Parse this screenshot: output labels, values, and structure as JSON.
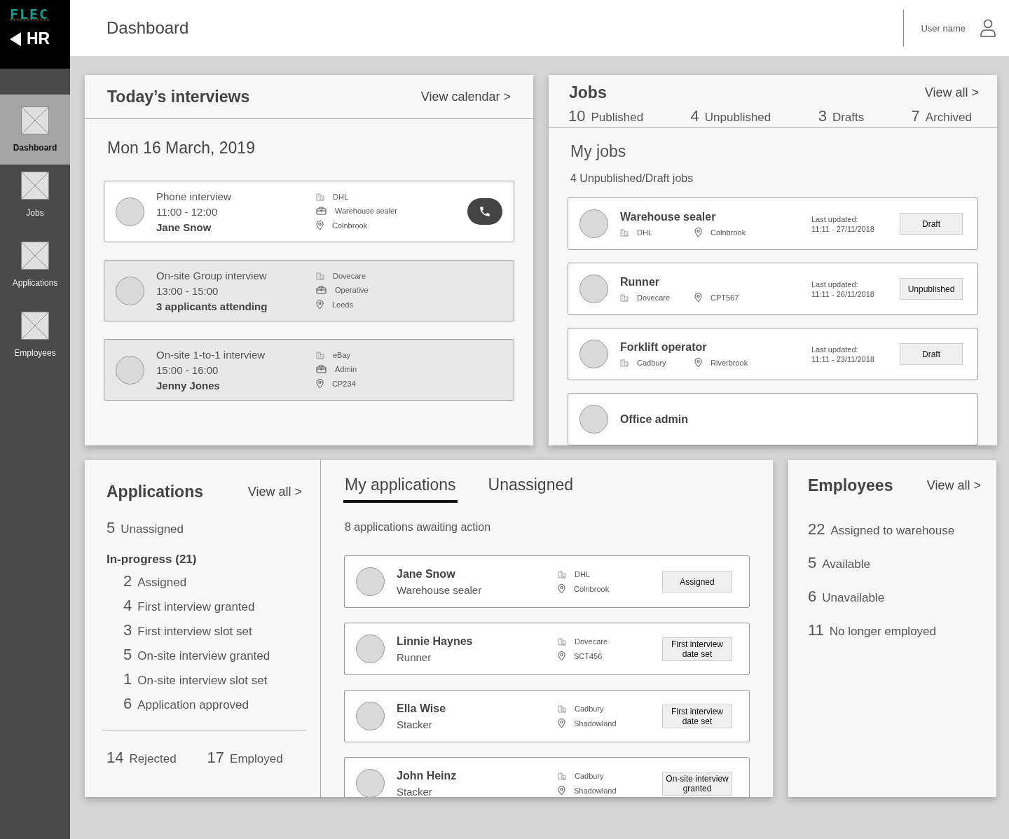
{
  "logo": {
    "brand": "FLEC",
    "section": "HR"
  },
  "sidebar": {
    "items": [
      {
        "label": "Dashboard",
        "selected": true
      },
      {
        "label": "Jobs",
        "selected": false
      },
      {
        "label": "Applications",
        "selected": false
      },
      {
        "label": "Employees",
        "selected": false
      }
    ]
  },
  "header": {
    "title": "Dashboard",
    "user": "User name"
  },
  "interviews": {
    "title": "Today’s interviews",
    "link": "View calendar >",
    "date": "Mon 16 March, 2019",
    "items": [
      {
        "type": "Phone interview",
        "time": "11:00 - 12:00",
        "who": "Jane Snow",
        "company": "DHL",
        "role": "Warehouse sealer",
        "location": "Colnbrook",
        "highlighted": true,
        "call": true
      },
      {
        "type": "On-site Group interview",
        "time": "13:00 - 15:00",
        "who": "3 applicants attending",
        "company": "Dovecare",
        "role": "Operative",
        "location": "Leeds",
        "highlighted": false,
        "call": false
      },
      {
        "type": "On-site 1-to-1 interview",
        "time": "15:00 - 16:00",
        "who": "Jenny Jones",
        "company": "eBay",
        "role": "Admin",
        "location": "CP234",
        "highlighted": false,
        "call": false
      }
    ]
  },
  "jobs": {
    "title": "Jobs",
    "link": "View all >",
    "stats": [
      {
        "count": "10",
        "label": "Published"
      },
      {
        "count": "4",
        "label": "Unpublished"
      },
      {
        "count": "3",
        "label": "Drafts"
      },
      {
        "count": "7",
        "label": "Archived"
      }
    ],
    "subtitle": "My jobs",
    "summary": "4 Unpublished/Draft jobs",
    "items": [
      {
        "title": "Warehouse sealer",
        "company": "DHL",
        "location": "Colnbrook",
        "updated_label": "Last updated:",
        "updated": "11:11 - 27/11/2018",
        "status": "Draft"
      },
      {
        "title": "Runner",
        "company": "Dovecare",
        "location": "CPT567",
        "updated_label": "Last updated:",
        "updated": "11:11 - 26/11/2018",
        "status": "Unpublished"
      },
      {
        "title": "Forklift operator",
        "company": "Cadbury",
        "location": "Riverbrook",
        "updated_label": "Last updated:",
        "updated": "11:11 - 23/11/2018",
        "status": "Draft"
      },
      {
        "title": "Office admin"
      }
    ]
  },
  "applications": {
    "title": "Applications",
    "link": "View all >",
    "unassigned": {
      "count": "5",
      "label": "Unassigned"
    },
    "in_progress": {
      "title": "In-progress (21)",
      "items": [
        {
          "count": "2",
          "label": "Assigned"
        },
        {
          "count": "4",
          "label": "First interview granted"
        },
        {
          "count": "3",
          "label": "First interview slot set"
        },
        {
          "count": "5",
          "label": "On-site interview granted"
        },
        {
          "count": "1",
          "label": "On-site interview slot set"
        },
        {
          "count": "6",
          "label": "Application approved"
        }
      ]
    },
    "totals": [
      {
        "count": "14",
        "label": "Rejected"
      },
      {
        "count": "17",
        "label": "Employed"
      }
    ],
    "tabs": [
      {
        "label": "My applications",
        "selected": true
      },
      {
        "label": "Unassigned",
        "selected": false
      }
    ],
    "summary": "8 applications awaiting action",
    "items": [
      {
        "name": "Jane Snow",
        "role": "Warehouse sealer",
        "company": "DHL",
        "location": "Colnbrook",
        "status": "Assigned"
      },
      {
        "name": "Linnie Haynes",
        "role": "Runner",
        "company": "Dovecare",
        "location": "SCT456",
        "status": "First interview date set"
      },
      {
        "name": "Ella Wise",
        "role": "Stacker",
        "company": "Cadbury",
        "location": "Shadowland",
        "status": "First interview date set"
      },
      {
        "name": "John Heinz",
        "role": "Stacker",
        "company": "Cadbury",
        "location": "Shadowland",
        "status": "On-site interview granted"
      }
    ]
  },
  "employees": {
    "title": "Employees",
    "link": "View all >",
    "items": [
      {
        "count": "22",
        "label": "Assigned to warehouse"
      },
      {
        "count": "5",
        "label": "Available"
      },
      {
        "count": "6",
        "label": "Unavailable"
      },
      {
        "count": "11",
        "label": "No longer employed"
      }
    ]
  }
}
